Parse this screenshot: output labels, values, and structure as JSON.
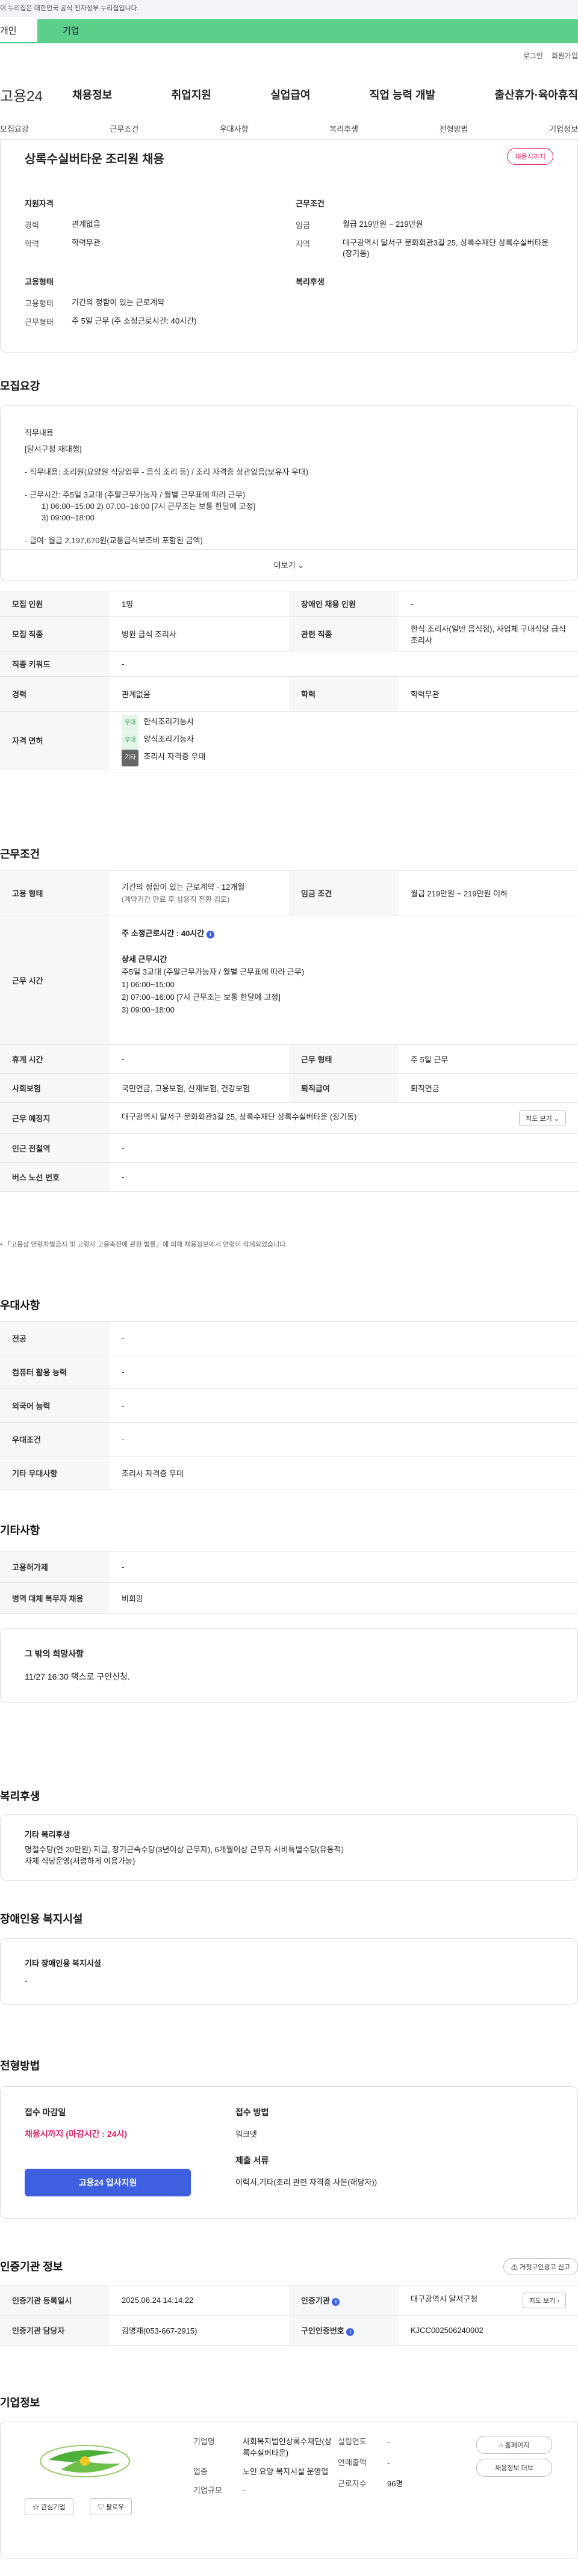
{
  "gov_notice": "이 누리집은 대한민국 공식 전자정부 누리집입니다.",
  "tabs": [
    "개인",
    "기업"
  ],
  "util": [
    "로그인",
    "회원가입"
  ],
  "logo": "고용24",
  "gnb": [
    "채용정보",
    "취업지원",
    "실업급여",
    "직업 능력 개발",
    "출산휴가·육아휴직"
  ],
  "subnav": [
    "모집요강",
    "근무조건",
    "우대사항",
    "복리후생",
    "전형방법",
    "기업정보"
  ],
  "summary": {
    "title": "상록수실버타운 조리원 채용",
    "status": "채용시까지",
    "qual_heading": "지원자격",
    "work_heading": "근무조건",
    "emp_heading": "고용형태",
    "welfare_heading": "복리후생",
    "qual": [
      {
        "k": "경력",
        "v": "관계없음"
      },
      {
        "k": "학력",
        "v": "학력무관"
      }
    ],
    "work": [
      {
        "k": "임금",
        "v": "월급 219만원 ~ 219만원"
      },
      {
        "k": "지역",
        "v": "대구광역시 달서구 문화회관3길 25, 상록수재단 상록수실버타운 (장기동)"
      }
    ],
    "emp": [
      {
        "k": "고용형태",
        "v": "기간의 정함이 있는 근로계약"
      },
      {
        "k": "근무형태",
        "v": "주 5일 근무 (주 소정근로시간: 40시간)"
      }
    ]
  },
  "recruit": {
    "heading": "모집요강",
    "detail_label": "직무내용",
    "detail_lines": [
      "[달서구청 재대행]",
      "- 직무내용: 조리원(요양원 식당업무 - 음식 조리 등) / 조리 자격증 상관없음(보유자 우대)",
      "- 근무시간: 주5일 3교대 (주말근무가능자 / 월별 근무표에 따라 근무)",
      "1) 06:00~15:00  2) 07:00~16:00 [7시 근무조는 보통 한달에 고정]",
      "3) 09:00~18:00",
      "- 급여: 월급 2,197,670원(교통급식보조비 포함된 금액)"
    ],
    "more": "더보기",
    "rows": [
      {
        "k1": "모집 인원",
        "v1": "1명",
        "k2": "장애인 채용 인원",
        "v2": "-"
      },
      {
        "k1": "모집 직종",
        "v1": "병원 급식 조리사",
        "k2": "관련 직종",
        "v2": "한식 조리사(일반 음식점), 사업체 구내식당 급식 조리사"
      },
      {
        "k1": "직종 키워드",
        "v1": "-"
      },
      {
        "k1": "경력",
        "v1": "관계없음",
        "k2": "학력",
        "v2": "학력무관"
      }
    ],
    "license_label": "자격 면허",
    "licenses": [
      {
        "badge": "우대",
        "name": "한식조리기능사"
      },
      {
        "badge": "우대",
        "name": "양식조리기능사"
      },
      {
        "badge": "기타",
        "name": "조리사 자격증 우대"
      }
    ]
  },
  "conditions": {
    "heading": "근무조건",
    "emp_type_label": "고용 형태",
    "emp_type": "기간의 정함이 있는 근로계약 · 12개월",
    "emp_type_note": "(계약기간 만료 후 상용직 전환 검토)",
    "wage_label": "임금 조건",
    "wage": "월급 219만원 ~ 219만원 이하",
    "hours_label": "근무 시간",
    "hours_total": "주 소정근로시간 : 40시간",
    "hours_detail_title": "상세 근무시간",
    "hours_detail": [
      "주5일 3교대 (주말근무가능자 / 월별 근무표에 따라 근무)",
      "1) 06:00~15:00",
      "2) 07:00~16:00 [7시 근무조는 보통 한달에 고정]",
      "3) 09:00~18:00"
    ],
    "rows": [
      {
        "k1": "휴게 시간",
        "v1": "-",
        "k2": "근무 형태",
        "v2": "주 5일 근무"
      },
      {
        "k1": "사회보험",
        "v1": "국민연금, 고용보험, 산재보험, 건강보험",
        "k2": "퇴직급여",
        "v2": "퇴직연금"
      }
    ],
    "place_label": "근무 예정지",
    "place": "대구광역시 달서구 문화회관3길 25, 상록수재단 상록수실버타운 (장기동)",
    "map_btn": "지도 보기",
    "subway_label": "인근 전철역",
    "subway": "-",
    "bus_label": "버스 노선 번호",
    "bus": "-",
    "footnote": "「고용상 연령차별금지 및 고령자 고용촉진에 관한 법률」에 의해 채용정보에서 연령이 삭제되었습니다."
  },
  "preferences": {
    "heading": "우대사항",
    "rows": [
      {
        "k": "전공",
        "v": "-"
      },
      {
        "k": "컴퓨터 활용 능력",
        "v": "-"
      },
      {
        "k": "외국어 능력",
        "v": "-"
      },
      {
        "k": "우대조건",
        "v": "-"
      },
      {
        "k": "기타 우대사항",
        "v": "조리사 자격증 우대"
      }
    ]
  },
  "other": {
    "heading": "기타사항",
    "rows": [
      {
        "k": "고용허가제",
        "v": "-"
      },
      {
        "k": "병역 대체 복무자 채용",
        "v": "비희망"
      }
    ],
    "request_title": "그 밖의 희망사항",
    "request": "11/27 16:30 택스로 구인신청."
  },
  "welfare": {
    "heading": "복리후생",
    "title": "기타 복리후생",
    "lines": [
      "명절수당(연 20만원) 지급, 장기근속수당(3년이상 근무자), 6개월이상 근무자 사비특별수당(유동적)",
      "자체 식당운영(저렴하게 이용가능)"
    ]
  },
  "disabled": {
    "heading": "장애인용 복지시설",
    "title": "기타 장애인용 복지시설",
    "value": "-"
  },
  "selection": {
    "heading": "전형방법",
    "deadline_label": "접수 마감일",
    "deadline": "채용시까지 (마감시간 : 24시)",
    "apply_btn": "고용24 입사지원",
    "method_label": "접수 방법",
    "method": "워크넷",
    "docs_label": "제출 서류",
    "docs": "이력서,기타(조리 관련 자격증 사본(해당자))"
  },
  "agency": {
    "heading": "인증기관 정보",
    "report_btn": "거짓구인광고 신고",
    "rows": [
      {
        "k1": "인증기관 등록일시",
        "v1": "2025.06.24 14:14:22",
        "k2": "인증기관",
        "v2": "대구광역시 달서구청",
        "btn": "지도 보기"
      },
      {
        "k1": "인증기관 담당자",
        "v1": "김명재(053-667-2915)",
        "k2": "구인인증번호",
        "v2": "KJCC002506240002"
      }
    ]
  },
  "company": {
    "heading": "기업정보",
    "interest_btn": "관심기업",
    "follow_btn": "팔로우",
    "left": [
      {
        "k": "기업명",
        "v": "사회복지법인상록수재단(상록수실버타운)"
      },
      {
        "k": "업종",
        "v": "노인 요양 복지시설 운영업"
      },
      {
        "k": "기업규모",
        "v": "-"
      }
    ],
    "right": [
      {
        "k": "설립연도",
        "v": "-"
      },
      {
        "k": "연매출액",
        "v": "-"
      },
      {
        "k": "근로자수",
        "v": "96명"
      }
    ],
    "home_btn": "홈페이지",
    "jobs_btn": "채용정보 더보"
  },
  "colors": {
    "brand_green": "#5cd08b",
    "accent_pink": "#e6256b",
    "apply_blue": "#3d5fe0",
    "logo_green": "#4caf3a"
  }
}
